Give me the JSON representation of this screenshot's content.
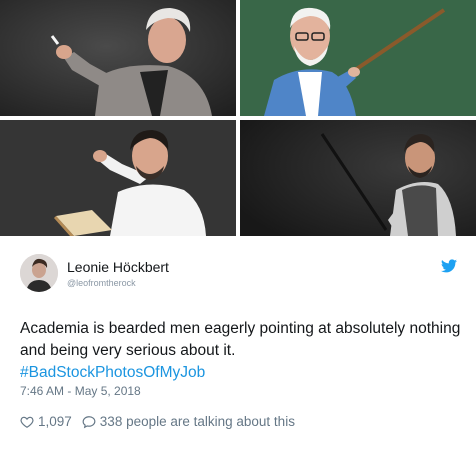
{
  "tweet": {
    "display_name": "Leonie Höckbert",
    "handle": "@leofromtherock",
    "text_main": "Academia is bearded men eagerly pointing at absolutely nothing and being very serious about it.",
    "hashtag": "#BadStockPhotosOfMyJob",
    "timestamp": "7:46 AM - May 5, 2018",
    "likes": "1,097",
    "talking": "338 people are talking about this"
  },
  "icons": {
    "brand": "twitter-bird-icon",
    "like": "heart-icon",
    "reply": "speech-bubble-icon"
  },
  "colors": {
    "link": "#1b95e0",
    "text": "#14171a",
    "muted": "#657786",
    "twitter_blue": "#1da1f2"
  }
}
